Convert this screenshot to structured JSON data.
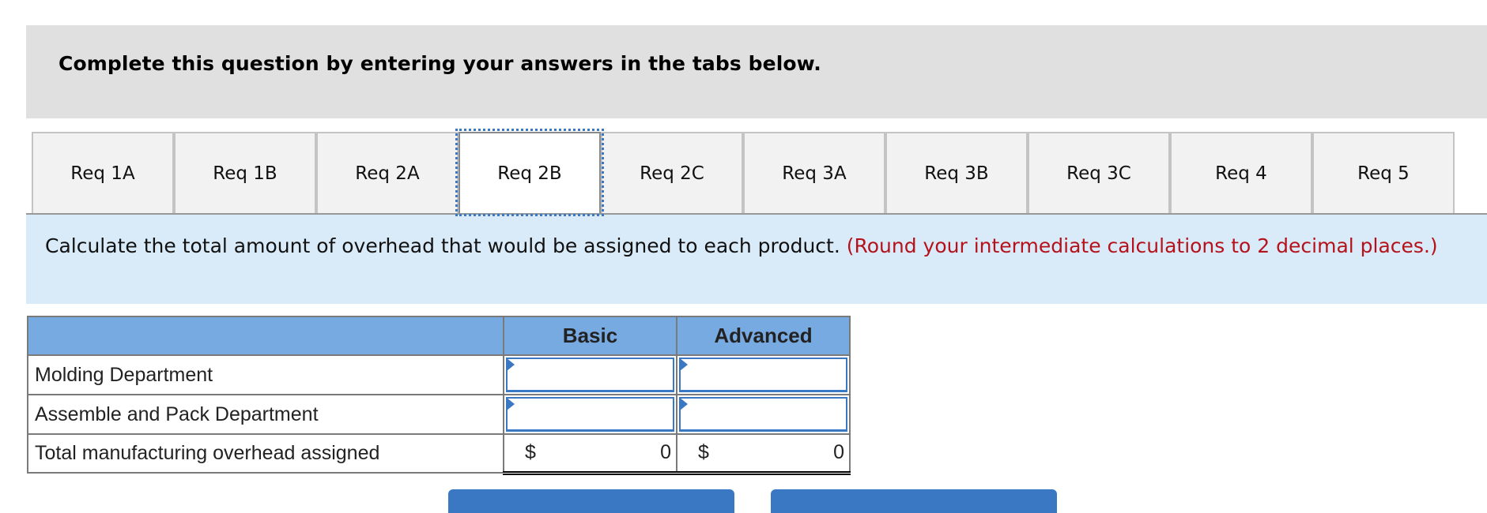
{
  "header": {
    "title": "Complete this question by entering your answers in the tabs below."
  },
  "tabs": [
    {
      "label": "Req 1A",
      "active": false
    },
    {
      "label": "Req 1B",
      "active": false
    },
    {
      "label": "Req 2A",
      "active": false
    },
    {
      "label": "Req 2B",
      "active": true
    },
    {
      "label": "Req 2C",
      "active": false
    },
    {
      "label": "Req 3A",
      "active": false
    },
    {
      "label": "Req 3B",
      "active": false
    },
    {
      "label": "Req 3C",
      "active": false
    },
    {
      "label": "Req 4",
      "active": false
    },
    {
      "label": "Req 5",
      "active": false
    }
  ],
  "instruction": {
    "text": "Calculate the total amount of overhead that would be assigned to each product.",
    "note": "(Round your intermediate calculations to 2 decimal places.)"
  },
  "table": {
    "columns": [
      "",
      "Basic",
      "Advanced"
    ],
    "rows": [
      {
        "label": "Molding Department",
        "basic": "",
        "advanced": ""
      },
      {
        "label": "Assemble and Pack Department",
        "basic": "",
        "advanced": ""
      },
      {
        "label": "Total manufacturing overhead assigned",
        "basic_currency": "$",
        "basic": "0",
        "advanced_currency": "$",
        "advanced": "0"
      }
    ]
  },
  "colors": {
    "accent": "#3a78c4",
    "header_bg": "#e0e0e0",
    "instruction_bg": "#d9eaf8",
    "table_header_bg": "#78aae2",
    "note_red": "#b5121b"
  }
}
